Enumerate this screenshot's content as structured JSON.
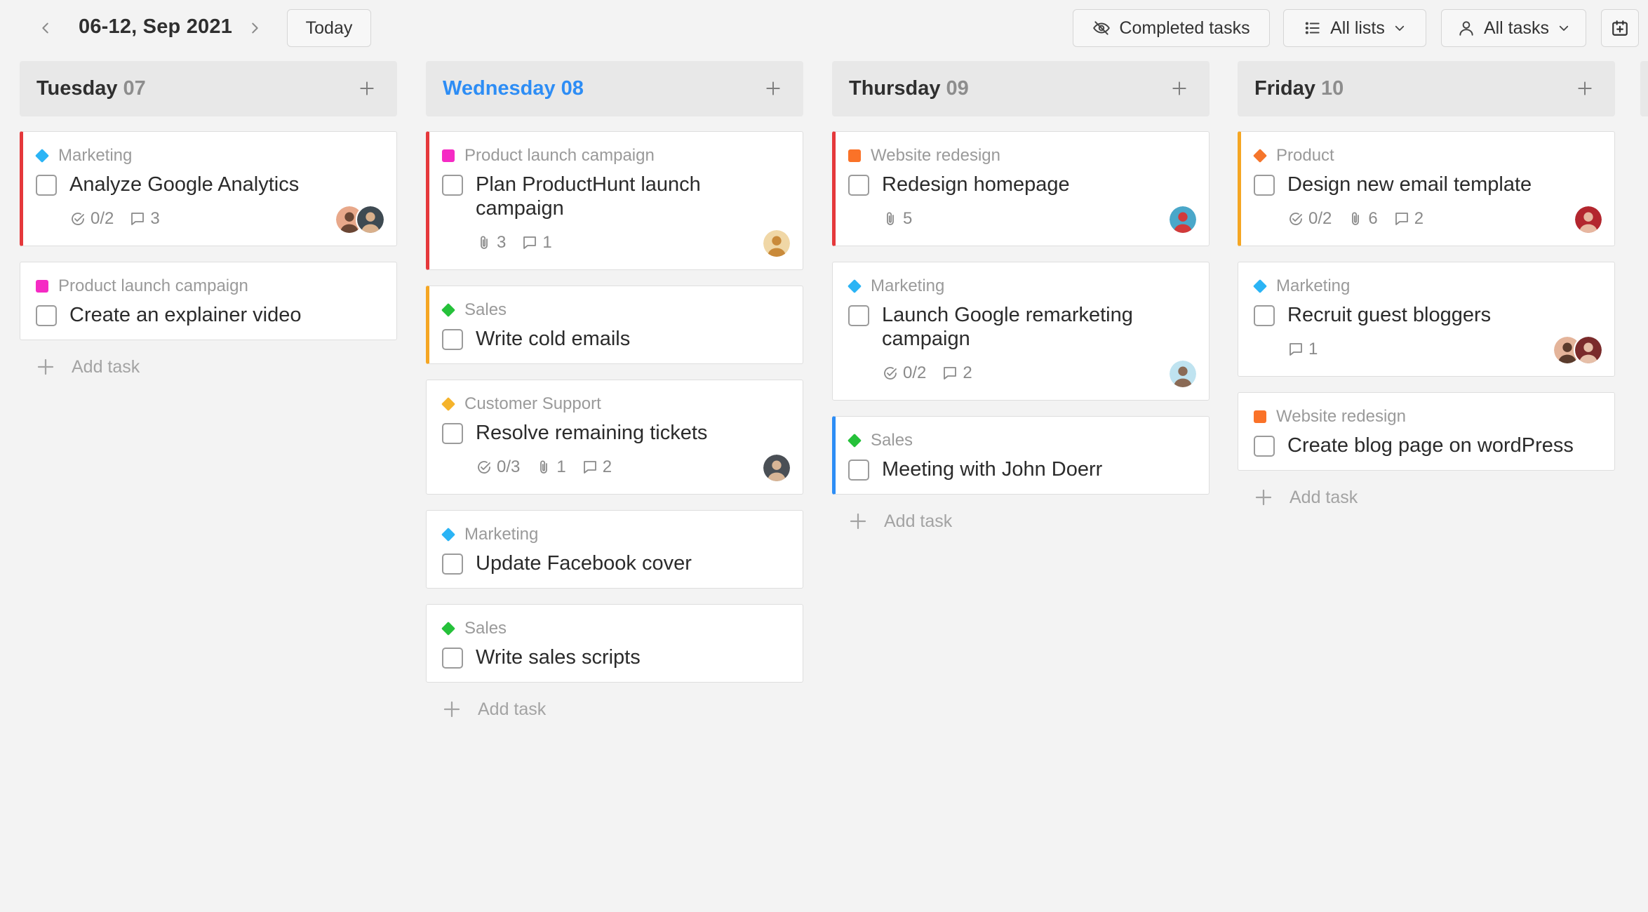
{
  "toolbar": {
    "date_range": "06-12, Sep 2021",
    "today_label": "Today",
    "completed_label": "Completed tasks",
    "lists_label": "All lists",
    "tasks_label": "All tasks"
  },
  "add_task_label": "Add task",
  "colors": {
    "accent_blue": "#2d8df5",
    "red": "#e5383b",
    "orange": "#f5a623",
    "blue": "#2d8df5",
    "marketing": "#2bb4f5",
    "product_launch": "#f52bc4",
    "sales": "#25c13a",
    "customer_support": "#f5b32b",
    "website_redesign": "#fa7228",
    "product": "#f5752b"
  },
  "columns": [
    {
      "day": "Tuesday",
      "num": "07",
      "today": false,
      "cards": [
        {
          "list": "Marketing",
          "marker": "diamond",
          "color": "#2bb4f5",
          "accent": "#e5383b",
          "title": "Analyze Google Analytics",
          "subtasks": "0/2",
          "attachments": "",
          "comments": "3",
          "avatars": [
            [
              "#e8a88a",
              "#6a4634"
            ],
            [
              "#3e4a52",
              "#d9b08c"
            ]
          ]
        },
        {
          "list": "Product launch campaign",
          "marker": "square",
          "color": "#f52bc4",
          "accent": "",
          "title": "Create an explainer video",
          "subtasks": "",
          "attachments": "",
          "comments": "",
          "avatars": []
        }
      ]
    },
    {
      "day": "Wednesday",
      "num": "08",
      "today": true,
      "cards": [
        {
          "list": "Product launch campaign",
          "marker": "square",
          "color": "#f52bc4",
          "accent": "#e5383b",
          "title": "Plan ProductHunt launch campaign",
          "subtasks": "",
          "attachments": "3",
          "comments": "1",
          "avatars": [
            [
              "#f0d7a6",
              "#c98a3a"
            ]
          ]
        },
        {
          "list": "Sales",
          "marker": "diamond",
          "color": "#25c13a",
          "accent": "#f5a623",
          "title": "Write cold emails",
          "subtasks": "",
          "attachments": "",
          "comments": "",
          "avatars": []
        },
        {
          "list": "Customer Support",
          "marker": "diamond",
          "color": "#f5b32b",
          "accent": "",
          "title": "Resolve remaining tickets",
          "subtasks": "0/3",
          "attachments": "1",
          "comments": "2",
          "avatars": [
            [
              "#4a4f55",
              "#d8b596"
            ]
          ]
        },
        {
          "list": "Marketing",
          "marker": "diamond",
          "color": "#2bb4f5",
          "accent": "",
          "title": "Update Facebook cover",
          "subtasks": "",
          "attachments": "",
          "comments": "",
          "avatars": []
        },
        {
          "list": "Sales",
          "marker": "diamond",
          "color": "#25c13a",
          "accent": "",
          "title": "Write sales scripts",
          "subtasks": "",
          "attachments": "",
          "comments": "",
          "avatars": []
        }
      ]
    },
    {
      "day": "Thursday",
      "num": "09",
      "today": false,
      "cards": [
        {
          "list": "Website redesign",
          "marker": "square",
          "color": "#fa7228",
          "accent": "#e5383b",
          "title": "Redesign homepage",
          "subtasks": "",
          "attachments": "5",
          "comments": "",
          "avatars": [
            [
              "#4aa7c9",
              "#d23a3a"
            ]
          ]
        },
        {
          "list": "Marketing",
          "marker": "diamond",
          "color": "#2bb4f5",
          "accent": "",
          "title": "Launch Google remarketing campaign",
          "subtasks": "0/2",
          "attachments": "",
          "comments": "2",
          "avatars": [
            [
              "#bfe3f0",
              "#8a6a55"
            ]
          ]
        },
        {
          "list": "Sales",
          "marker": "diamond",
          "color": "#25c13a",
          "accent": "#2d8df5",
          "title": "Meeting with John Doerr",
          "subtasks": "",
          "attachments": "",
          "comments": "",
          "avatars": []
        }
      ]
    },
    {
      "day": "Friday",
      "num": "10",
      "today": false,
      "cards": [
        {
          "list": "Product",
          "marker": "diamond",
          "color": "#f5752b",
          "accent": "#f5a623",
          "title": "Design new email template",
          "subtasks": "0/2",
          "attachments": "6",
          "comments": "2",
          "avatars": [
            [
              "#b3262e",
              "#e7b7a0"
            ]
          ]
        },
        {
          "list": "Marketing",
          "marker": "diamond",
          "color": "#2bb4f5",
          "accent": "",
          "title": "Recruit guest bloggers",
          "subtasks": "",
          "attachments": "",
          "comments": "1",
          "avatars": [
            [
              "#e4b49a",
              "#5a3b2c"
            ],
            [
              "#7a2b2b",
              "#e6bfa8"
            ]
          ]
        },
        {
          "list": "Website redesign",
          "marker": "square",
          "color": "#fa7228",
          "accent": "",
          "title": "Create blog page on wordPress",
          "subtasks": "",
          "attachments": "",
          "comments": "",
          "avatars": []
        }
      ]
    }
  ]
}
